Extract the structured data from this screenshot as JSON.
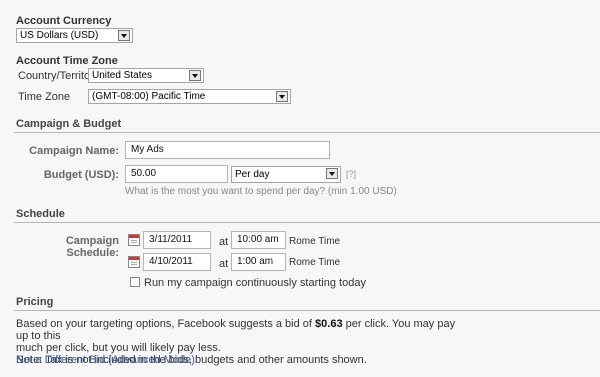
{
  "currency": {
    "heading": "Account Currency",
    "selected": "US Dollars (USD)"
  },
  "timezone": {
    "heading": "Account Time Zone",
    "country_label": "Country/Territory",
    "country_value": "United States",
    "zone_label": "Time Zone",
    "zone_value": "(GMT-08:00) Pacific Time"
  },
  "campaign": {
    "section_title": "Campaign & Budget",
    "name_label": "Campaign Name:",
    "name_value": "My Ads",
    "budget_label": "Budget (USD):",
    "budget_value": "50.00",
    "budget_period": "Per day",
    "help_mark": "[?]",
    "budget_hint": "What is the most you want to spend per day? (min 1.00 USD)"
  },
  "schedule": {
    "section_title": "Schedule",
    "label": "Campaign Schedule:",
    "start_date": "3/11/2011",
    "start_at": "at",
    "start_time": "10:00 am",
    "start_tz": "Rome Time",
    "end_date": "4/10/2011",
    "end_at": "at",
    "end_time": "1:00 am",
    "end_tz": "Rome Time",
    "continuous_label": "Run my campaign continuously starting today",
    "continuous_checked": false
  },
  "pricing": {
    "section_title": "Pricing",
    "line1_pre": "Based on your targeting options, Facebook suggests a bid of ",
    "bid": "$0.63",
    "line1_post": " per click. You may pay up to this",
    "line2": "much per click, but you will likely pay less.",
    "note": "Note: Tax is not included in the bids, budgets and other amounts shown.",
    "advanced_link": "Set a Different Bid (Advanced Mode)"
  }
}
